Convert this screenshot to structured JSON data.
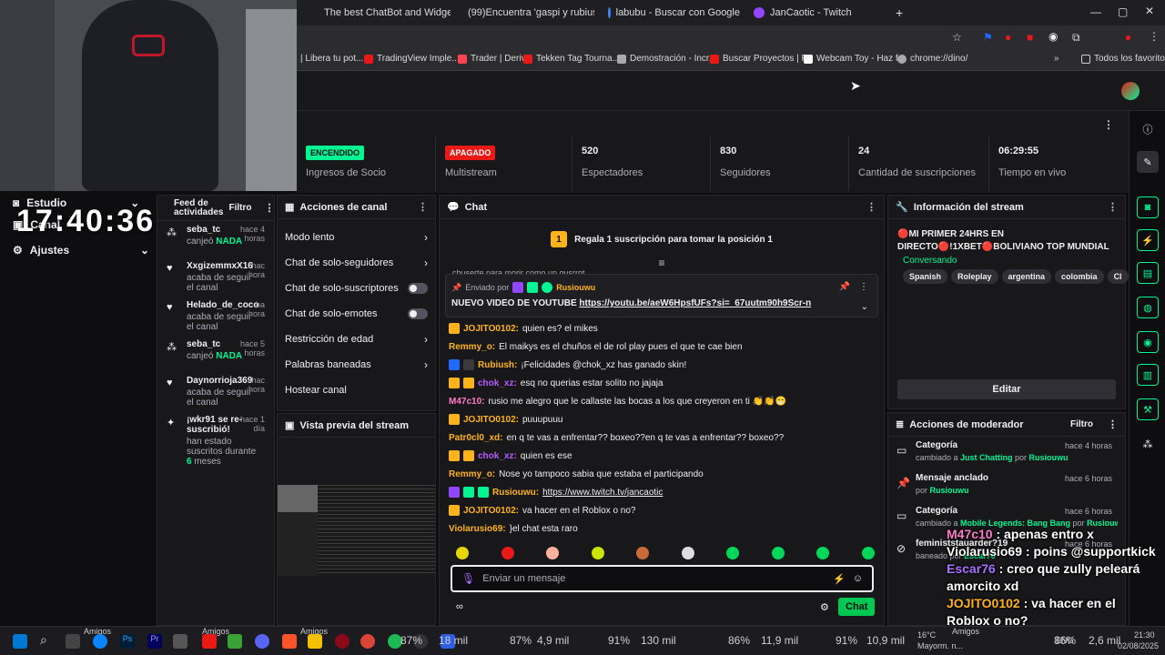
{
  "tabs": [
    {
      "title": "The best ChatBot and Widgets",
      "color": "#ffffff"
    },
    {
      "title": "(99)Encuentra 'gaspi y rubius b",
      "color": "#25f4ee"
    },
    {
      "title": "labubu - Buscar con Google",
      "color": "#4285f4"
    },
    {
      "title": "JanCaotic - Twitch",
      "color": "#9147ff"
    }
  ],
  "bookmarks": [
    {
      "title": "| Libera tu pot...",
      "color": "#888888"
    },
    {
      "title": "TradingView Imple...",
      "color": "#e91916"
    },
    {
      "title": "Trader | Deriv",
      "color": "#ff444f"
    },
    {
      "title": "Tekken Tag Tourna...",
      "color": "#e91916"
    },
    {
      "title": "Demostración - Incr...",
      "color": "#aaaaaa"
    },
    {
      "title": "Buscar Proyectos | F...",
      "color": "#e91916"
    },
    {
      "title": "Webcam Toy - Haz f...",
      "color": "#ffffff"
    },
    {
      "title": "chrome://dino/",
      "color": "#aaaaaa"
    },
    {
      "title": "Todos los favoritos",
      "color": "#aaaaaa"
    }
  ],
  "stats": [
    {
      "badge": "ENCENDIDO",
      "badge_color": "#00f593",
      "label": "Ingresos de Socio"
    },
    {
      "badge": "APAGADO",
      "badge_color": "#e91916",
      "label": "Multistream"
    },
    {
      "value": "520",
      "label": "Espectadores"
    },
    {
      "value": "830",
      "label": "Seguidores"
    },
    {
      "value": "24",
      "label": "Cantidad de suscripciones"
    },
    {
      "value": "06:29:55",
      "label": "Tiempo en vivo"
    }
  ],
  "overlay": {
    "clock": "17:40:36",
    "menu": [
      {
        "label": "Estudio",
        "icon": "camera-icon"
      },
      {
        "label": "Canal",
        "icon": "channel-icon"
      },
      {
        "label": "Ajustes",
        "icon": "gear-icon"
      }
    ]
  },
  "feed": {
    "title": "Feed de actividades",
    "filter": "Filtro",
    "items": [
      {
        "name": "seba_tc",
        "time": "hace 4 horas",
        "pre": "canjeó",
        "highlight": "NADA",
        "post": "",
        "icon": "points-icon"
      },
      {
        "name": "XxgizemmxX16",
        "time": "hac hora",
        "pre": "acaba de seguir el canal",
        "highlight": "",
        "post": "",
        "icon": "heart-icon"
      },
      {
        "name": "Helado_de_coco",
        "time": "ha hora",
        "pre": "acaba de seguir el canal",
        "highlight": "",
        "post": "",
        "icon": "heart-icon"
      },
      {
        "name": "seba_tc",
        "time": "hace 5 horas",
        "pre": "canjeó",
        "highlight": "NADA",
        "post": "",
        "icon": "points-icon"
      },
      {
        "name": "Daynorrioja369",
        "time": "hac hora",
        "pre": "acaba de seguir el canal",
        "highlight": "",
        "post": "",
        "icon": "heart-icon"
      },
      {
        "name": "¡wkr91 se re-suscribió!",
        "time": "hace 1 día",
        "pre": "han estado suscritos durante",
        "highlight": "6",
        "post": "meses",
        "icon": "star-icon"
      }
    ]
  },
  "actions": {
    "title": "Acciones de canal",
    "items": [
      {
        "label": "Modo lento",
        "kind": "chevron"
      },
      {
        "label": "Chat de solo-seguidores",
        "kind": "chevron"
      },
      {
        "label": "Chat de solo-suscriptores",
        "kind": "toggle"
      },
      {
        "label": "Chat de solo-emotes",
        "kind": "toggle"
      },
      {
        "label": "Restricción de edad",
        "kind": "chevron"
      },
      {
        "label": "Palabras baneadas",
        "kind": "chevron"
      },
      {
        "label": "Hostear canal",
        "kind": "none"
      }
    ]
  },
  "preview": {
    "title": "Vista previa del stream"
  },
  "chat": {
    "title": "Chat",
    "sub_gift": "Regala 1 suscripción para tomar la posición 1",
    "sub_gift_rank": "1",
    "cut_line": "chuserte para morir como un gusrrot",
    "pinned": {
      "by_label": "Enviado por",
      "by_user": "Rusiouwu",
      "text_pre": "NUEVO VIDEO DE YOUTUBE",
      "link": "https://youtu.be/aeW6HpsfUFs?si=_67uutm90h9Scr-n"
    },
    "messages": [
      {
        "user": "JOJITO0102",
        "color": "#ffb31a",
        "text": "quien es? el mikes",
        "badges": [
          "#ffb31a"
        ]
      },
      {
        "user": "Remmy_o",
        "color": "#ffb31a",
        "text": "El maikys es el chuños el de rol play pues el que te cae bien",
        "badges": []
      },
      {
        "user": "Rubiush",
        "color": "#ffb31a",
        "text": "¡Felicidades @chok_xz has ganado skin!",
        "badges": [
          "#1f69ff",
          "#3a3a3d"
        ]
      },
      {
        "user": "chok_xz",
        "color": "#b65cff",
        "text": "esq no querias estar solito no jajaja",
        "badges": [
          "#ffb31a",
          "#ffb31a"
        ]
      },
      {
        "user": "M47c10",
        "color": "#ff7bc8",
        "text": "rusio me alegro que le callaste las bocas a los que creyeron en ti 👏👏😁",
        "badges": []
      },
      {
        "user": "JOJITO0102",
        "color": "#ffb31a",
        "text": "puuupuuu",
        "badges": [
          "#ffb31a"
        ]
      },
      {
        "user": "Patr0cl0_xd",
        "color": "#ffb31a",
        "text": "en q te vas a enfrentar?? boxeo??en q te vas a enfrentar?? boxeo??",
        "badges": []
      },
      {
        "user": "chok_xz",
        "color": "#b65cff",
        "text": "quien es ese",
        "badges": [
          "#ffb31a",
          "#ffb31a"
        ]
      },
      {
        "user": "Remmy_o",
        "color": "#ffb31a",
        "text": "Nose yo tampoco sabia que estaba el participando",
        "badges": []
      },
      {
        "user": "Rusiouwu",
        "color": "#ffb31a",
        "text": "https://www.twitch.tv/jancaotic",
        "badges": [
          "#9147ff",
          "#00f593",
          "#00f593"
        ],
        "link": true
      },
      {
        "user": "JOJITO0102",
        "color": "#ffb31a",
        "text": "va hacer en el Roblox o no?",
        "badges": [
          "#ffb31a"
        ]
      },
      {
        "user": "Violarusio69",
        "color": "#ffb31a",
        "text": "}el chat esta raro",
        "badges": []
      }
    ],
    "input_placeholder": "Enviar un mensaje",
    "send": "Chat"
  },
  "info": {
    "title": "Información del stream",
    "stream_title": "🔴MI PRIMER 24HRS EN DIRECTO🔴!1XBET🔴BOLIVIANO TOP MUNDIAL D...",
    "category": "Conversando",
    "tags": [
      "Spanish",
      "Roleplay",
      "argentina",
      "colombia",
      "Cl"
    ],
    "edit": "Editar"
  },
  "mod": {
    "title": "Acciones de moderador",
    "filter": "Filtro",
    "items": [
      {
        "title": "Categoría",
        "time": "hace 4 horas",
        "line": "cambiado a",
        "hl": "Just Chatting",
        "by": "por",
        "user": "Rusiouwu",
        "icon": "category-icon"
      },
      {
        "title": "Mensaje anclado",
        "time": "hace 6 horas",
        "line": "",
        "hl": "",
        "by": "por",
        "user": "Rusiouwu",
        "icon": "pin-icon"
      },
      {
        "title": "Categoría",
        "time": "hace 6 horas",
        "line": "cambiado a",
        "hl": "Mobile Legends: Bang Bang",
        "by": "por",
        "user": "Rusiouwu",
        "icon": "category-icon"
      },
      {
        "title": "feministstauarder?19",
        "time": "hace 6 horas",
        "line": "baneado por",
        "hl": "",
        "by": "",
        "user": "Escar76",
        "icon": "ban-icon"
      }
    ]
  },
  "overlay_chat": [
    {
      "user": "M47c10",
      "color": "#ff7bc8",
      "text": ": apenas entro x"
    },
    {
      "user": "Violarusio69",
      "color": "#ffffff",
      "text": ": poins @supportkick"
    },
    {
      "user": "Escar76",
      "color": "#a970ff",
      "text": ": creo que zully peleará amorcito xd"
    },
    {
      "user": "JOJITO0102",
      "color": "#ffb31a",
      "text": ": va hacer en el Roblox o no?"
    },
    {
      "user": "Violarusio69",
      "color": "#ffffff",
      "text": ": }el chat esta raro"
    }
  ],
  "taskbar": {
    "amigos": "Amigos",
    "stats": [
      "87%",
      "18 mil",
      "87%",
      "4,9 mil",
      "91%",
      "130 mil",
      "86%",
      "11,9 mil",
      "91%",
      "10,9 mil",
      "86%",
      "2,6 mil"
    ],
    "weather": "16°C",
    "weather_sub": "Mayorm. n...",
    "lang": "ENG",
    "time": "21:30",
    "date": "02/08/2025"
  }
}
